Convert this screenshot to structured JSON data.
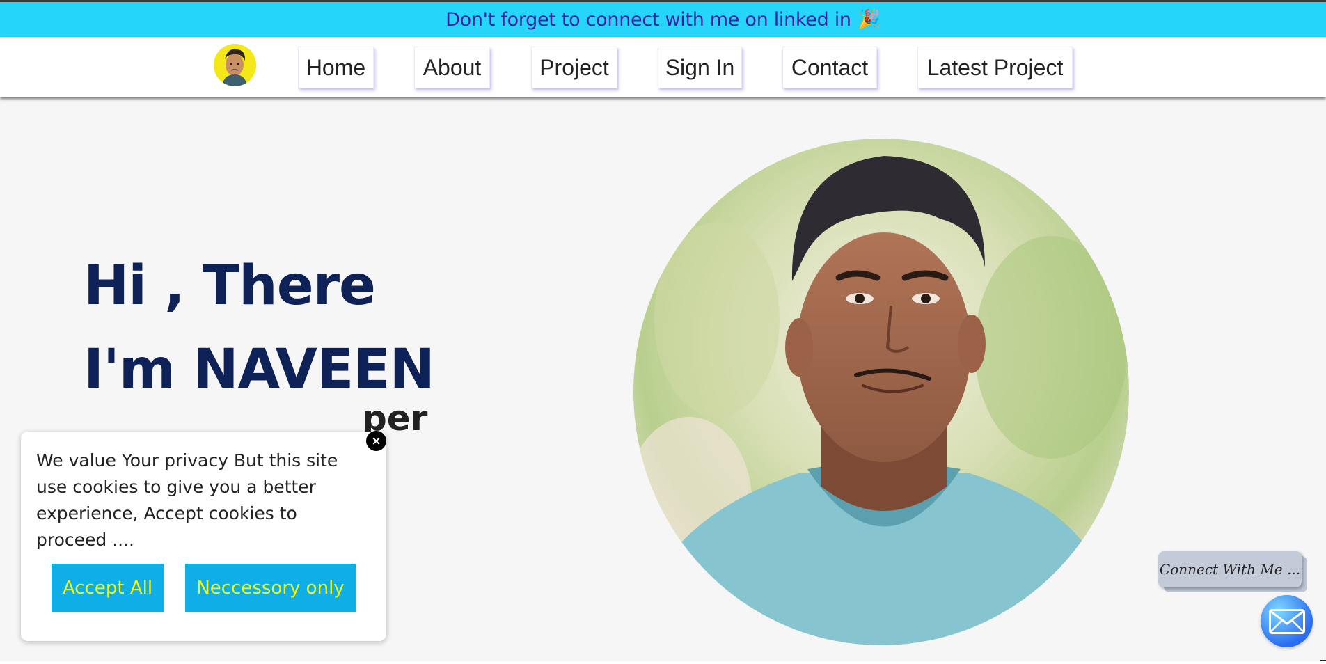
{
  "banner": {
    "text": "Don't forget to connect with me on linked in",
    "emoji": "🎉"
  },
  "nav": {
    "items": [
      "Home",
      "About",
      "Project",
      "Sign In",
      "Contact",
      "Latest Project"
    ]
  },
  "hero": {
    "greeting": "Hi , There",
    "name_line": "I'm NAVEEN",
    "role_fragment": "per"
  },
  "cookie": {
    "message": "We value Your privacy But this site use cookies to give you a better experience, Accept cookies to proceed ....",
    "accept_all": "Accept All",
    "necessary_only": "Neccessory only",
    "close_symbol": "×"
  },
  "connect": {
    "label": "Connect With Me ..."
  },
  "icons": {
    "banner": "party-popper-icon",
    "logo": "avatar-icon",
    "close": "close-icon",
    "mail": "mail-icon"
  },
  "colors": {
    "banner_bg": "#25d6fa",
    "banner_text": "#3f1ca6",
    "heading": "#0e2257",
    "cookie_button_bg": "#10aee6",
    "cookie_button_text": "#f2f513"
  }
}
